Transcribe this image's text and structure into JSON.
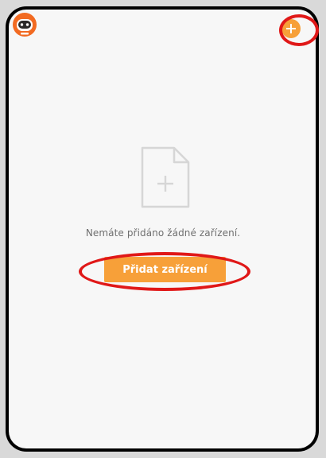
{
  "header": {
    "logo_icon": "robot-logo-icon",
    "add_icon": "plus-icon"
  },
  "empty_state": {
    "icon": "document-add-icon",
    "message": "Nemáte přidáno žádné zařízení.",
    "button_label": "Přidat zařízení"
  },
  "colors": {
    "accent": "#f7a039",
    "highlight": "#e01818",
    "background": "#f7f7f7"
  }
}
